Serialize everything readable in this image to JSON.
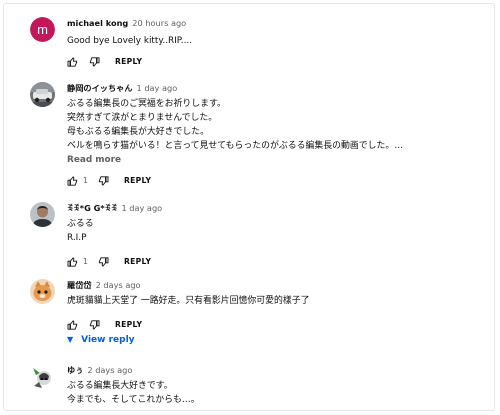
{
  "comments": [
    {
      "author": "michael kong",
      "time": "20 hours ago",
      "avatar_letter": "m",
      "avatar_color": "#c2185b",
      "lines": [
        "Good bye Lovely kitty..RIP...."
      ],
      "likes": "",
      "reply_label": "REPLY"
    },
    {
      "author": "静岡のイッちゃん",
      "time": "1 day ago",
      "lines": [
        "ぶるる編集長のご冥福をお祈りします。",
        "突然すぎて涙がとまりませんでした。",
        "母もぶるる編集長が大好きでした。",
        "ベルを鳴らす猫がいる！と言って見せてもらったのがぶるる編集長の動画でした。…"
      ],
      "read_more": "Read more",
      "likes": "1",
      "reply_label": "REPLY"
    },
    {
      "author": "ꉂꉂ*G G*ꉂꉂ",
      "time": "1 day ago",
      "lines": [
        "ぶるる",
        "R.I.P"
      ],
      "likes": "1",
      "reply_label": "REPLY"
    },
    {
      "author": "羅岱岱",
      "time": "2 days ago",
      "lines": [
        "虎斑貓貓上天堂了 一路好走。只有看影片回憶你可愛的樣子了"
      ],
      "likes": "",
      "reply_label": "REPLY",
      "view_reply": "View reply"
    },
    {
      "author": "ゆぅ",
      "time": "2 days ago",
      "lines": [
        "ぶるる編集長大好きです。",
        "今までも、そしてこれからも…。"
      ]
    }
  ]
}
